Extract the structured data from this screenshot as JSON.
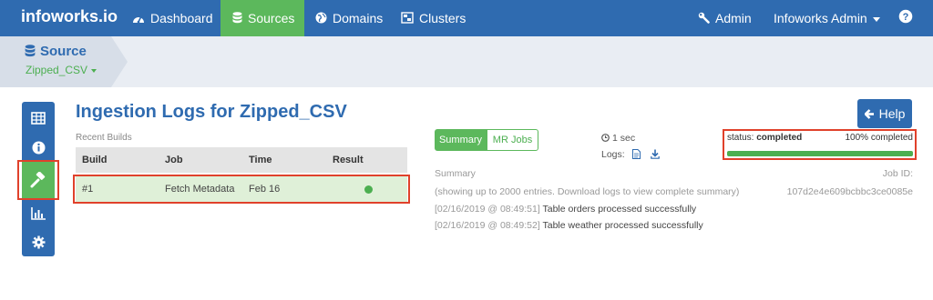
{
  "nav": {
    "brand": "infoworks.io",
    "items": [
      {
        "label": "Dashboard",
        "icon": "dashboard-icon"
      },
      {
        "label": "Sources",
        "icon": "database-icon",
        "active": true
      },
      {
        "label": "Domains",
        "icon": "globe-icon"
      },
      {
        "label": "Clusters",
        "icon": "clusters-icon"
      }
    ],
    "admin_label": "Admin",
    "user_label": "Infoworks Admin",
    "help_icon": "question-circle-icon"
  },
  "source": {
    "title": "Source",
    "name": "Zipped_CSV"
  },
  "rail": {
    "items": [
      "table-icon",
      "info-icon",
      "gavel-icon",
      "bar-chart-icon",
      "gear-icon"
    ],
    "active_index": 2
  },
  "main": {
    "title": "Ingestion Logs for Zipped_CSV",
    "recent_builds_label": "Recent Builds",
    "columns": [
      "Build",
      "Job",
      "Time",
      "Result"
    ],
    "rows": [
      {
        "build": "#1",
        "job": "Fetch Metadata",
        "time": "Feb 16",
        "result": "success"
      }
    ]
  },
  "detail": {
    "tabs": [
      "Summary",
      "MR Jobs"
    ],
    "duration": "1 sec",
    "logs_label": "Logs:",
    "status_label": "status:",
    "status_value": "completed",
    "percent_text": "100% completed",
    "progress": 1.0,
    "summary_label": "Summary",
    "job_id_label": "Job ID:",
    "job_id": "107d2e4e609bcbbc3ce0085e",
    "note": "(showing up to 2000 entries. Download logs to view complete summary)",
    "logs": [
      {
        "time": "[02/16/2019 @ 08:49:51]",
        "message": "Table orders processed successfully"
      },
      {
        "time": "[02/16/2019 @ 08:49:52]",
        "message": "Table weather processed successfully"
      }
    ],
    "help_label": "Help"
  },
  "colors": {
    "primary": "#2f6bb0",
    "success": "#5cb85c",
    "highlight": "#e0412b"
  }
}
